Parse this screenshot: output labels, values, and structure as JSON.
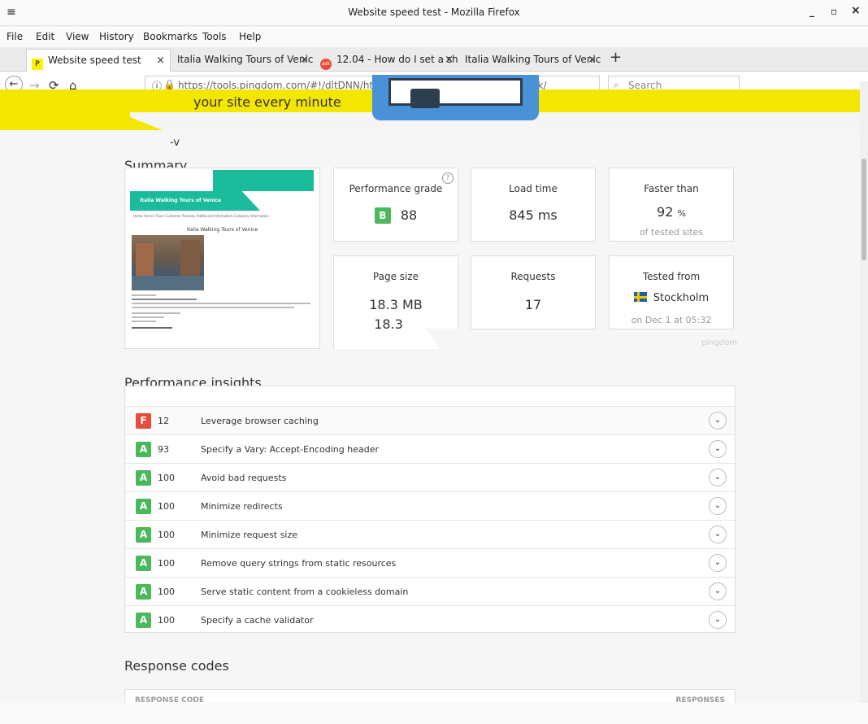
{
  "window": {
    "title": "Website speed test - Mozilla Firefox",
    "menu_glyph": "≡",
    "min": "_",
    "max": "▫",
    "close": "×"
  },
  "menu": [
    "File",
    "Edit",
    "View",
    "History",
    "Bookmarks",
    "Tools",
    "Help"
  ],
  "tabs": [
    {
      "label": "Website speed test",
      "favicon": "P"
    },
    {
      "label": "Italia Walking Tours of Venice",
      "favicon": ""
    },
    {
      "label": "12.04 - How do I set a sh",
      "favicon": "ask"
    },
    {
      "label": "Italia Walking Tours of Venice",
      "favicon": ""
    }
  ],
  "tab_close": "×",
  "tab_new": "+",
  "nav": {
    "back": "←",
    "forward": "→",
    "reload": "⟳",
    "home": "⌂",
    "url": "https://tools.pingdom.com/#!/dltDNN/https://dl68.host.cs.st-andrews.ac.uk/",
    "search_placeholder": "Search",
    "search_icon": "⌕",
    "info_icon": "ⓘ",
    "lock_icon": "🔒"
  },
  "hero": {
    "tagline": "your site every minute"
  },
  "summary": {
    "title": "Summary",
    "stray": "-v",
    "thumbnail": {
      "site_title": "Italia Walking Tours of Venice",
      "nav": "Home    Venice Tours    Customer Reviews    Additional Information    Company Information",
      "heading": "Italia Walking Tours of Venice"
    },
    "cards": [
      {
        "label": "Performance grade",
        "grade": "B",
        "value": "88",
        "help": "?"
      },
      {
        "label": "Load time",
        "value": "845 ms"
      },
      {
        "label": "Faster than",
        "value": "92",
        "unit": "%",
        "sub": "of tested sites"
      },
      {
        "label": "Page size",
        "value": "18.3 MB",
        "value_dup": "18.3"
      },
      {
        "label": "Requests",
        "value": "17"
      },
      {
        "label": "Tested from",
        "value": "Stockholm",
        "sub": "on Dec 1 at 05:32"
      }
    ],
    "watermark": "pingdom"
  },
  "insights": {
    "title": "Performance insights",
    "rows": [
      {
        "grade": "F",
        "score": "12",
        "text": "Leverage browser caching"
      },
      {
        "grade": "A",
        "score": "93",
        "text": "Specify a Vary: Accept-Encoding header"
      },
      {
        "grade": "A",
        "score": "100",
        "text": "Avoid bad requests"
      },
      {
        "grade": "A",
        "score": "100",
        "text": "Minimize redirects"
      },
      {
        "grade": "A",
        "score": "100",
        "text": "Minimize request size"
      },
      {
        "grade": "A",
        "score": "100",
        "text": "Remove query strings from static resources"
      },
      {
        "grade": "A",
        "score": "100",
        "text": "Serve static content from a cookieless domain"
      },
      {
        "grade": "A",
        "score": "100",
        "text": "Specify a cache validator"
      }
    ],
    "expand_glyph": "⌄"
  },
  "response_codes": {
    "title": "Response codes",
    "col1": "RESPONSE CODE",
    "col2": "RESPONSES"
  }
}
